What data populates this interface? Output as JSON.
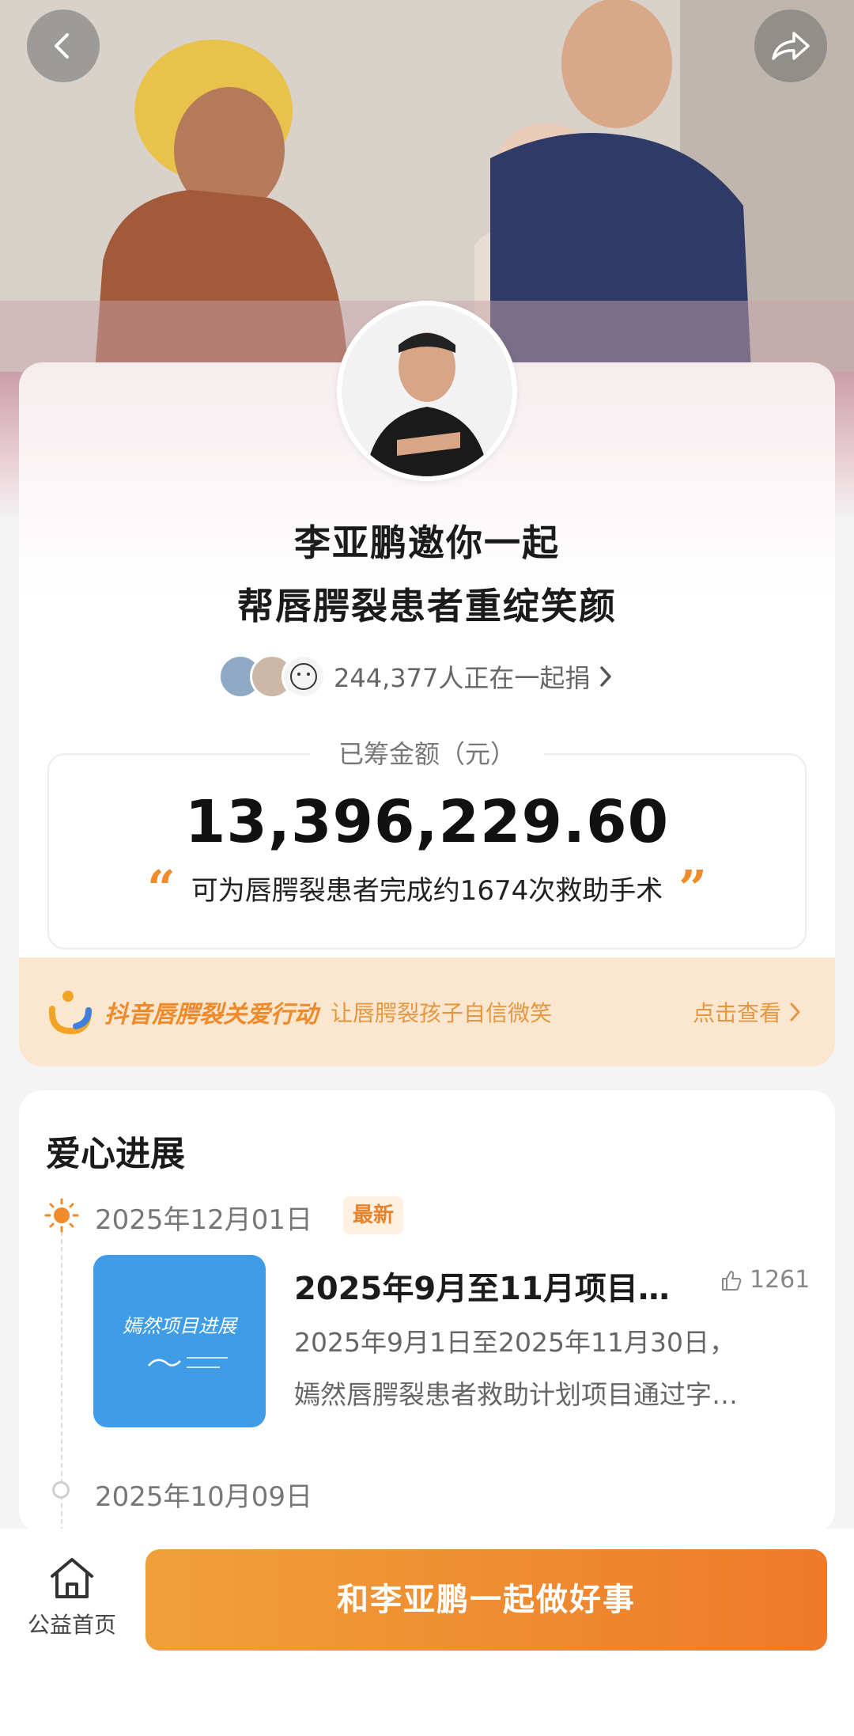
{
  "header": {
    "back_icon": "chevron-left-icon",
    "share_icon": "share-arrow-icon"
  },
  "hero": {
    "photo": "hero-photo"
  },
  "campaign_card": {
    "avatar": "avatar",
    "title_line1": "李亚鹏邀你一起",
    "title_line2": "帮唇腭裂患者重绽笑颜",
    "donors_text": "244,377人正在一起捐",
    "raised_label": "已筹金额（元）",
    "raised_amount": "13,396,229.60",
    "impact_text": "可为唇腭裂患者完成约1674次救助手术"
  },
  "campaign_banner": {
    "title": "抖音唇腭裂关爱行动",
    "subtitle": "让唇腭裂孩子自信微笑",
    "link": "点击查看"
  },
  "progress": {
    "section_title": "爱心进展",
    "items": [
      {
        "date": "2025年12月01日",
        "badge": "最新",
        "thumb_text": "嫣然项目进展",
        "title": "2025年9月至11月项目…",
        "likes": "1261",
        "desc_line1": "2025年9月1日至2025年11月30日，",
        "desc_line2": "嫣然唇腭裂患者救助计划项目通过字…"
      },
      {
        "date": "2025年10月09日"
      }
    ]
  },
  "bottom_bar": {
    "home_label": "公益首页",
    "cta_label": "和李亚鹏一起做好事"
  },
  "colors": {
    "accent": "#ee7a2a",
    "accent_light": "#fbe7cf",
    "thumb_blue": "#3f9ce6"
  }
}
